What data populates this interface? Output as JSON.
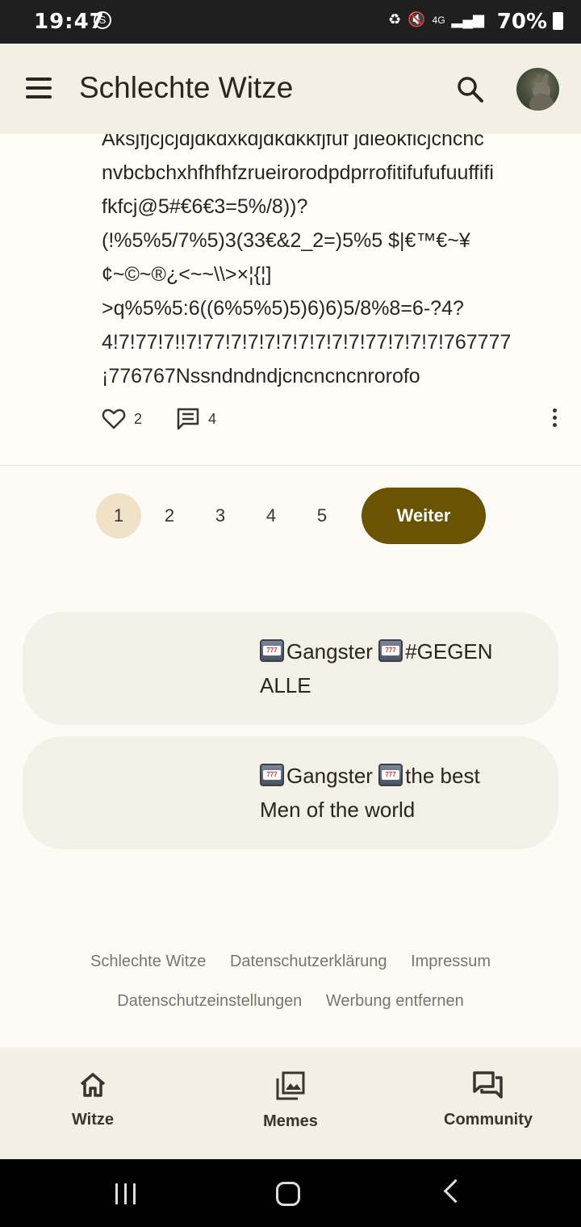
{
  "status_bar": {
    "time": "19:47",
    "battery": "70%",
    "network": "4G"
  },
  "app_bar": {
    "title": "Schlechte Witze"
  },
  "joke": {
    "text": "Aksjfjcjcjdjdkdxkdjdkdkkfjfuf jdieokficjchchc\nnvbcbchxhfhfhfzrueirorodpdprrofitifufufuuffifi\nfkfcj@5#€6€3=5%/8))?\n(!%5%5/7%5)3(33€&2_2=)5%5 $|€™€~¥\n¢~©~®¿<~~\\\\>×¦{¦]\n>q%5%5:6((6%5%5)5)6)6)5/8%8=6-?4?\n4!7!77!7!!7!77!7!7!7!7!7!7!7!7!77!7!7!7!767777\n¡776767Nssndndndjcncncncnrorofo",
    "likes": "2",
    "comments": "4"
  },
  "pagination": {
    "pages": [
      "1",
      "2",
      "3",
      "4",
      "5"
    ],
    "active": "1",
    "next_label": "Weiter"
  },
  "cards": [
    {
      "text": "Gangster ",
      "text2": "#GEGEN ALLE"
    },
    {
      "text": "Gangster ",
      "text2": "the best Men of the world"
    }
  ],
  "footer": {
    "links": [
      "Schlechte Witze",
      "Datenschutzerklärung",
      "Impressum",
      "Datenschutzeinstellungen",
      "Werbung entfernen"
    ]
  },
  "bottom_nav": {
    "items": [
      {
        "label": "Witze",
        "icon": "home-icon"
      },
      {
        "label": "Memes",
        "icon": "image-gallery-icon"
      },
      {
        "label": "Community",
        "icon": "forum-icon"
      }
    ]
  },
  "colors": {
    "accent": "#6b5304",
    "active_page": "#efe2c6",
    "bar_bg": "#f3efe4"
  }
}
